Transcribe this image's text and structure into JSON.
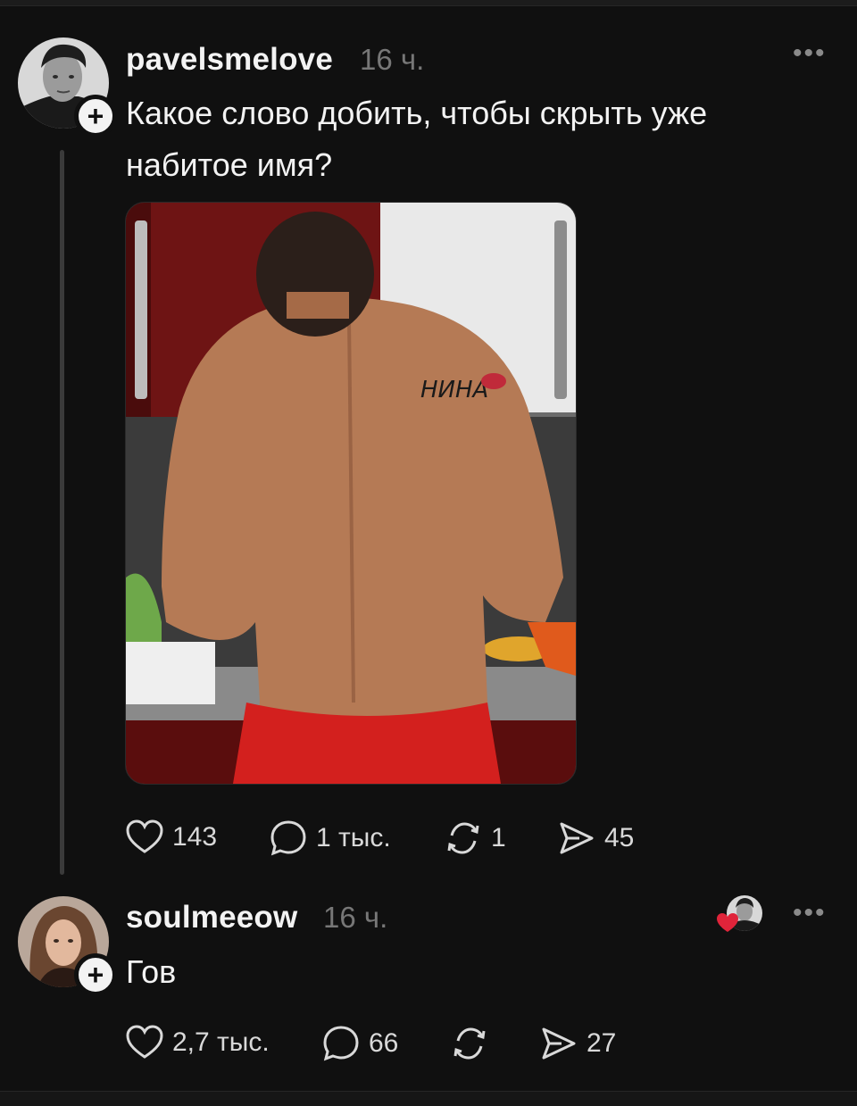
{
  "posts": [
    {
      "username": "pavelsmelove",
      "time": "16 ч.",
      "text": "Какое слово добить, чтобы скрыть уже набитое имя?",
      "image": {
        "tattoo_text": "НИНА"
      },
      "actions": {
        "likes": "143",
        "comments": "1 тыс.",
        "reposts": "1",
        "shares": "45"
      }
    },
    {
      "username": "soulmeeow",
      "time": "16 ч.",
      "text": "Гов",
      "actions": {
        "likes": "2,7 тыс.",
        "comments": "66",
        "reposts": "",
        "shares": "27"
      }
    }
  ],
  "icons": {
    "follow": "plus-icon",
    "more": "more-horizontal-icon",
    "like": "heart-icon",
    "comment": "comment-icon",
    "repost": "repost-icon",
    "share": "send-icon",
    "liked_by_author": "red-heart-icon"
  },
  "colors": {
    "background": "#101010",
    "text": "#f3f3f3",
    "muted": "#777777",
    "heart": "#e0243a"
  }
}
